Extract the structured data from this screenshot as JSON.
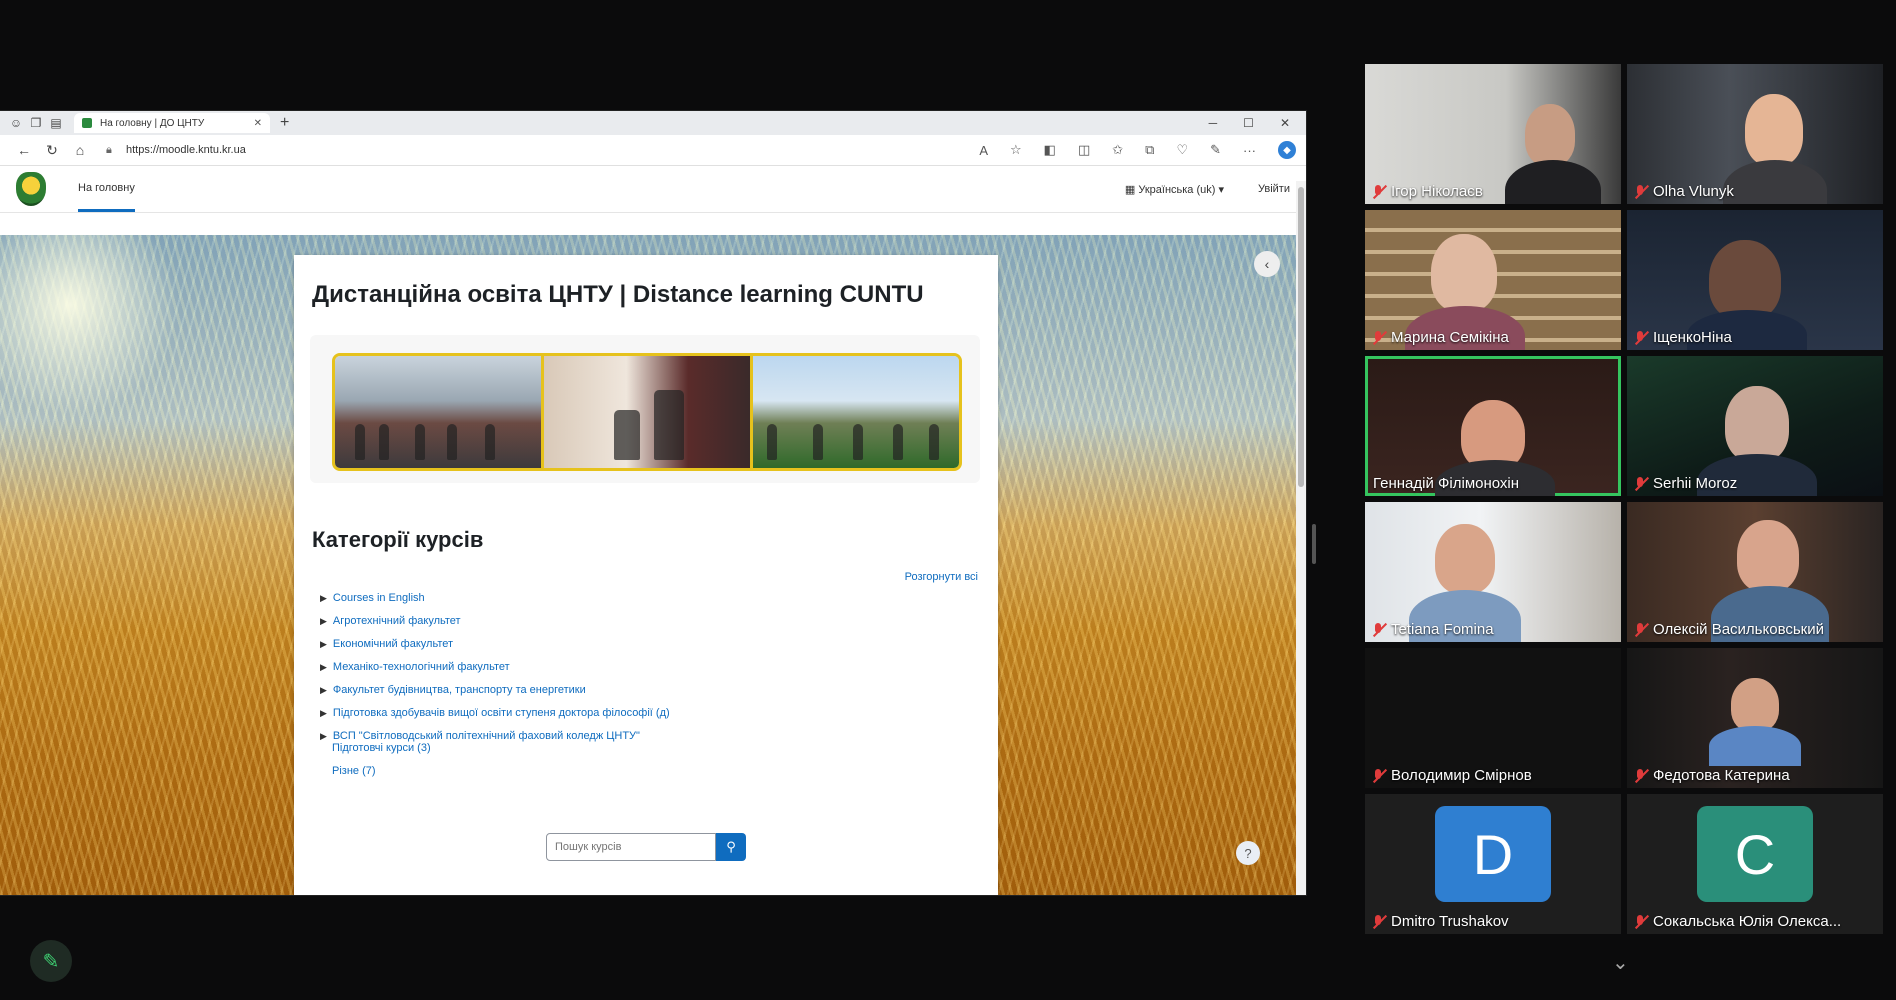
{
  "browser": {
    "tab_title": "На головну | ДО ЦНТУ",
    "url": "https://moodle.kntu.kr.ua"
  },
  "moodle": {
    "nav_home": "На головну",
    "language": "Українська (uk) ▾",
    "login": "Увійти",
    "site_title": "Дистанційна освіта ЦНТУ | Distance learning CUNTU",
    "categories_title": "Категорії курсів",
    "collapse_all": "Розгорнути всі",
    "categories": [
      "Courses in English",
      "Агротехнічний факультет",
      "Економічний факультет",
      "Механіко-технологічний факультет",
      "Факультет будівництва, транспорту та енергетики",
      "Підготовка здобувачів вищої освіти ступеня доктора філософії (д)",
      "ВСП \"Світловодський політехнічний фаховий коледж ЦНТУ\""
    ],
    "subcategories": [
      "Підготовчі курси (3)",
      "Різне (7)"
    ],
    "search_placeholder": "Пошук курсів"
  },
  "participants": [
    {
      "name": "Ігор Ніколаєв"
    },
    {
      "name": "Olha Vlunyk"
    },
    {
      "name": "Марина Семікіна"
    },
    {
      "name": "ІщенкоНіна"
    },
    {
      "name": "Геннадій Філімонохін"
    },
    {
      "name": "Serhii Moroz"
    },
    {
      "name": "Tetiana Fomina"
    },
    {
      "name": "Олексій Васильковський"
    },
    {
      "name": "Володимир Смірнов"
    },
    {
      "name": "Федотова Катерина"
    },
    {
      "name": "Dmitro Trushakov",
      "initial": "D",
      "color": "#2f7fd1"
    },
    {
      "name": "Сокальська Юлія Олекса...",
      "initial": "C",
      "color": "#2a8f7a"
    }
  ],
  "colors": {
    "moodle_blue": "#0f6cbf",
    "active_speaker": "#35c55f"
  }
}
